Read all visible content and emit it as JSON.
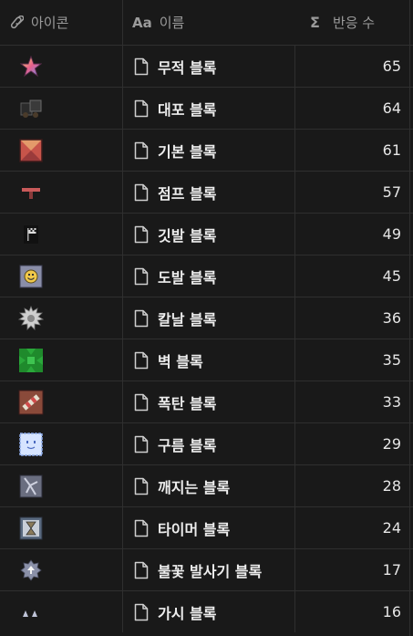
{
  "header": {
    "icon_col": {
      "icon": "link-icon",
      "label": "아이콘"
    },
    "name_col": {
      "icon": "text-type-icon",
      "icon_text": "Aa",
      "label": "이름"
    },
    "count_col": {
      "icon": "sigma-icon",
      "icon_text": "Σ",
      "label": "반응 수"
    }
  },
  "rows": [
    {
      "icon": "star-block-icon",
      "name": "무적 블록",
      "count": "65"
    },
    {
      "icon": "cannon-block-icon",
      "name": "대포 블록",
      "count": "64"
    },
    {
      "icon": "basic-block-icon",
      "name": "기본 블록",
      "count": "61"
    },
    {
      "icon": "jump-block-icon",
      "name": "점프 블록",
      "count": "57"
    },
    {
      "icon": "flag-block-icon",
      "name": "깃발 블록",
      "count": "49"
    },
    {
      "icon": "taunt-block-icon",
      "name": "도발 블록",
      "count": "45"
    },
    {
      "icon": "blade-block-icon",
      "name": "칼날 블록",
      "count": "36"
    },
    {
      "icon": "wall-block-icon",
      "name": "벽 블록",
      "count": "35"
    },
    {
      "icon": "bomb-block-icon",
      "name": "폭탄 블록",
      "count": "33"
    },
    {
      "icon": "cloud-block-icon",
      "name": "구름 블록",
      "count": "29"
    },
    {
      "icon": "breakable-block-icon",
      "name": "깨지는 블록",
      "count": "28"
    },
    {
      "icon": "timer-block-icon",
      "name": "타이머 블록",
      "count": "24"
    },
    {
      "icon": "firework-launcher-block-icon",
      "name": "불꽃 발사기 블록",
      "count": "17"
    },
    {
      "icon": "spike-block-icon",
      "name": "가시 블록",
      "count": "16"
    }
  ]
}
